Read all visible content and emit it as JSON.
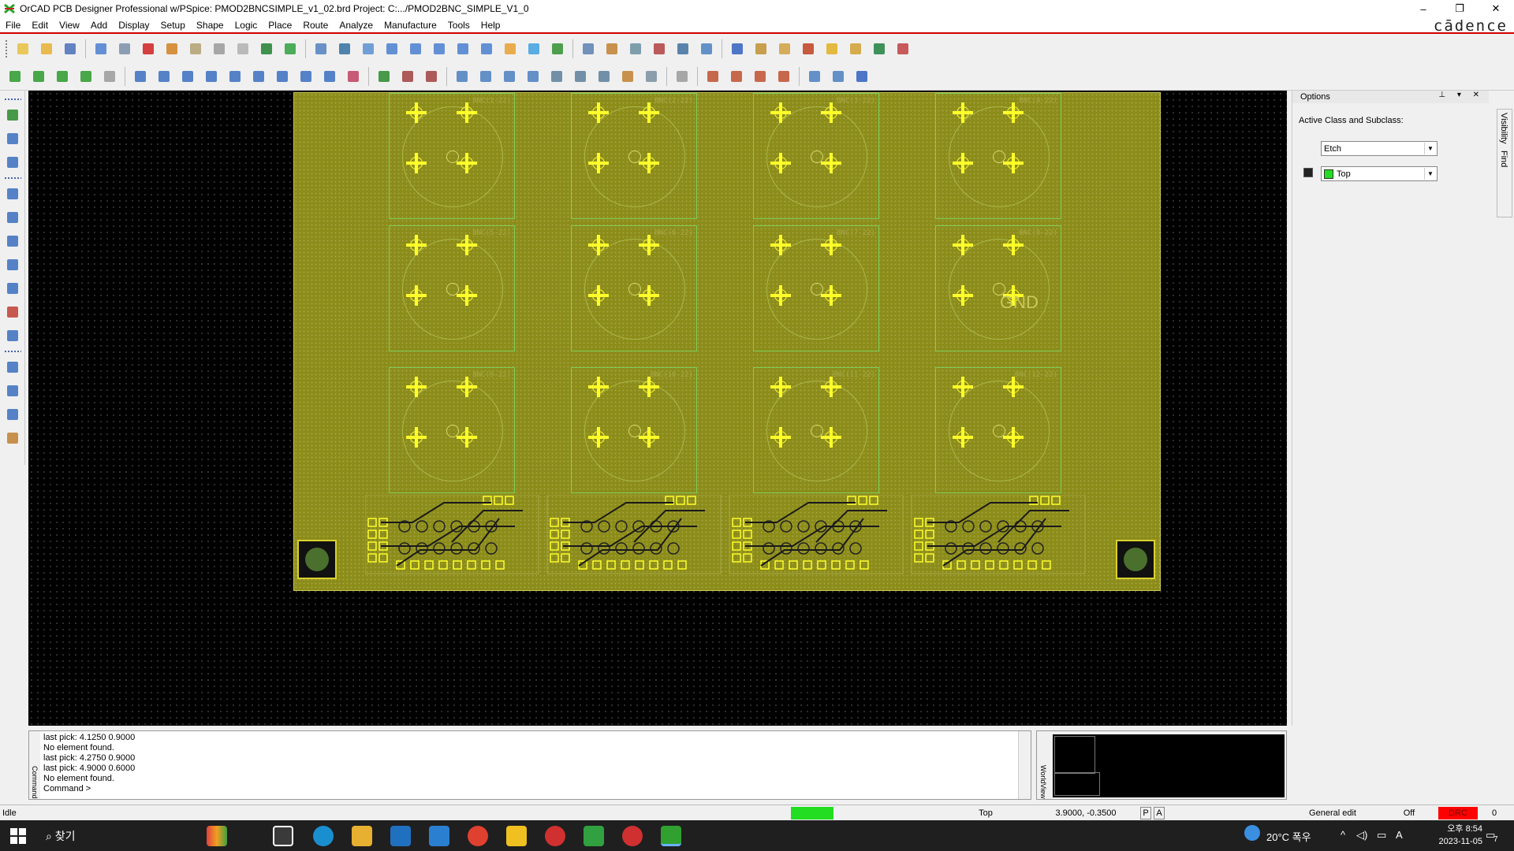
{
  "window": {
    "title": "OrCAD PCB Designer Professional w/PSpice: PMOD2BNCSIMPLE_v1_02.brd  Project: C:.../PMOD2BNC_SIMPLE_V1_0",
    "minimize": "–",
    "restore": "❐",
    "close": "✕"
  },
  "menu": {
    "items": [
      "File",
      "Edit",
      "View",
      "Add",
      "Display",
      "Setup",
      "Shape",
      "Logic",
      "Place",
      "Route",
      "Analyze",
      "Manufacture",
      "Tools",
      "Help"
    ],
    "brand": "cādence"
  },
  "board": {
    "gnd_label": "GND",
    "connector_refdes": [
      "BNC(1-22)",
      "BNC(2-22)",
      "BNC(3-22)",
      "BNC(4-22)",
      "BNC(5-22)",
      "BNC(6-22)",
      "BNC(7-22)",
      "BNC(8-22)",
      "BNC(9-22)",
      "BNC(10-22)",
      "BNC(11-22)",
      "BNC(12-22)"
    ]
  },
  "options_panel": {
    "title": "Options",
    "controls": "⊥ ▾ ✕",
    "active_class_label": "Active Class and Subclass:",
    "class_value": "Etch",
    "subclass_value": "Top",
    "subclass_color": "#22dd22",
    "side_tabs": [
      "Visibility",
      "Find"
    ]
  },
  "command": {
    "label": "Command",
    "lines": [
      "last pick:  4.1250  0.9000",
      "No element found.",
      "last pick:  4.2750  0.9000",
      "last pick:  4.9000  0.6000",
      "No element found.",
      "Command >"
    ]
  },
  "worldview": {
    "label": "WorldView"
  },
  "status": {
    "state": "Idle",
    "indicator_color": "#22dd22",
    "layer": "Top",
    "coords": "3.9000, -0.3500",
    "p_btn": "P",
    "a_btn": "A",
    "mode": "General edit",
    "off": "Off",
    "drc": "DRC",
    "drc_color": "#ff0000",
    "count": "0"
  },
  "taskbar": {
    "search": "찾기",
    "weather": "20°C  폭우",
    "ime": "A",
    "time": "오후 8:54",
    "date": "2023-11-05",
    "notifications": "7"
  }
}
